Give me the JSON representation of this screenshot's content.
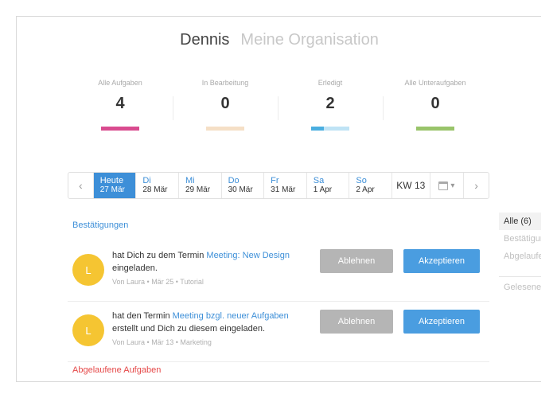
{
  "header": {
    "user": "Dennis",
    "organization": "Meine Organisation"
  },
  "stats": [
    {
      "label": "Alle Aufgaben",
      "value": "4",
      "bar": [
        {
          "color": "#d94b8f",
          "fraction": 1.0
        }
      ]
    },
    {
      "label": "In Bearbeitung",
      "value": "0",
      "bar": [
        {
          "color": "#f5dfc6",
          "fraction": 1.0
        }
      ]
    },
    {
      "label": "Erledigt",
      "value": "2",
      "bar": [
        {
          "color": "#4aaee0",
          "fraction": 0.33
        },
        {
          "color": "#bfe3f5",
          "fraction": 0.67
        }
      ]
    },
    {
      "label": "Alle Unteraufgaben",
      "value": "0",
      "bar": [
        {
          "color": "#99c46a",
          "fraction": 1.0
        }
      ]
    }
  ],
  "datebar": {
    "prev": "‹",
    "next": "›",
    "days": [
      {
        "name": "Heute",
        "date": "27 Mär",
        "active": true
      },
      {
        "name": "Di",
        "date": "28 Mär"
      },
      {
        "name": "Mi",
        "date": "29 Mär"
      },
      {
        "name": "Do",
        "date": "30 Mär"
      },
      {
        "name": "Fr",
        "date": "31 Mär"
      },
      {
        "name": "Sa",
        "date": "1 Apr"
      },
      {
        "name": "So",
        "date": "2 Apr"
      }
    ],
    "week": "KW 13",
    "calendar_icon": "calendar-icon",
    "caret": "▾"
  },
  "confirmations": {
    "title": "Bestätigungen",
    "items": [
      {
        "avatar": "L",
        "text_before": "hat Dich zu dem Termin ",
        "link": "Meeting: New Design",
        "text_after": " eingeladen.",
        "meta": "Von Laura • Mär 25 • Tutorial",
        "decline": "Ablehnen",
        "accept": "Akzeptieren"
      },
      {
        "avatar": "L",
        "text_before": "hat den Termin ",
        "link": "Meeting bzgl. neuer Aufgaben",
        "text_after": " erstellt und Dich zu diesem eingeladen.",
        "meta": "Von Laura • Mär 13 • Marketing",
        "decline": "Ablehnen",
        "accept": "Akzeptieren"
      }
    ]
  },
  "expired": {
    "title": "Abgelaufene Aufgaben"
  },
  "filters": {
    "items": [
      "Alle (6)",
      "Bestätigungen",
      "Abgelaufene"
    ],
    "read": "Gelesene"
  },
  "colors": {
    "accent": "#3d8fd8",
    "danger": "#e54848",
    "avatar": "#f5c532"
  }
}
